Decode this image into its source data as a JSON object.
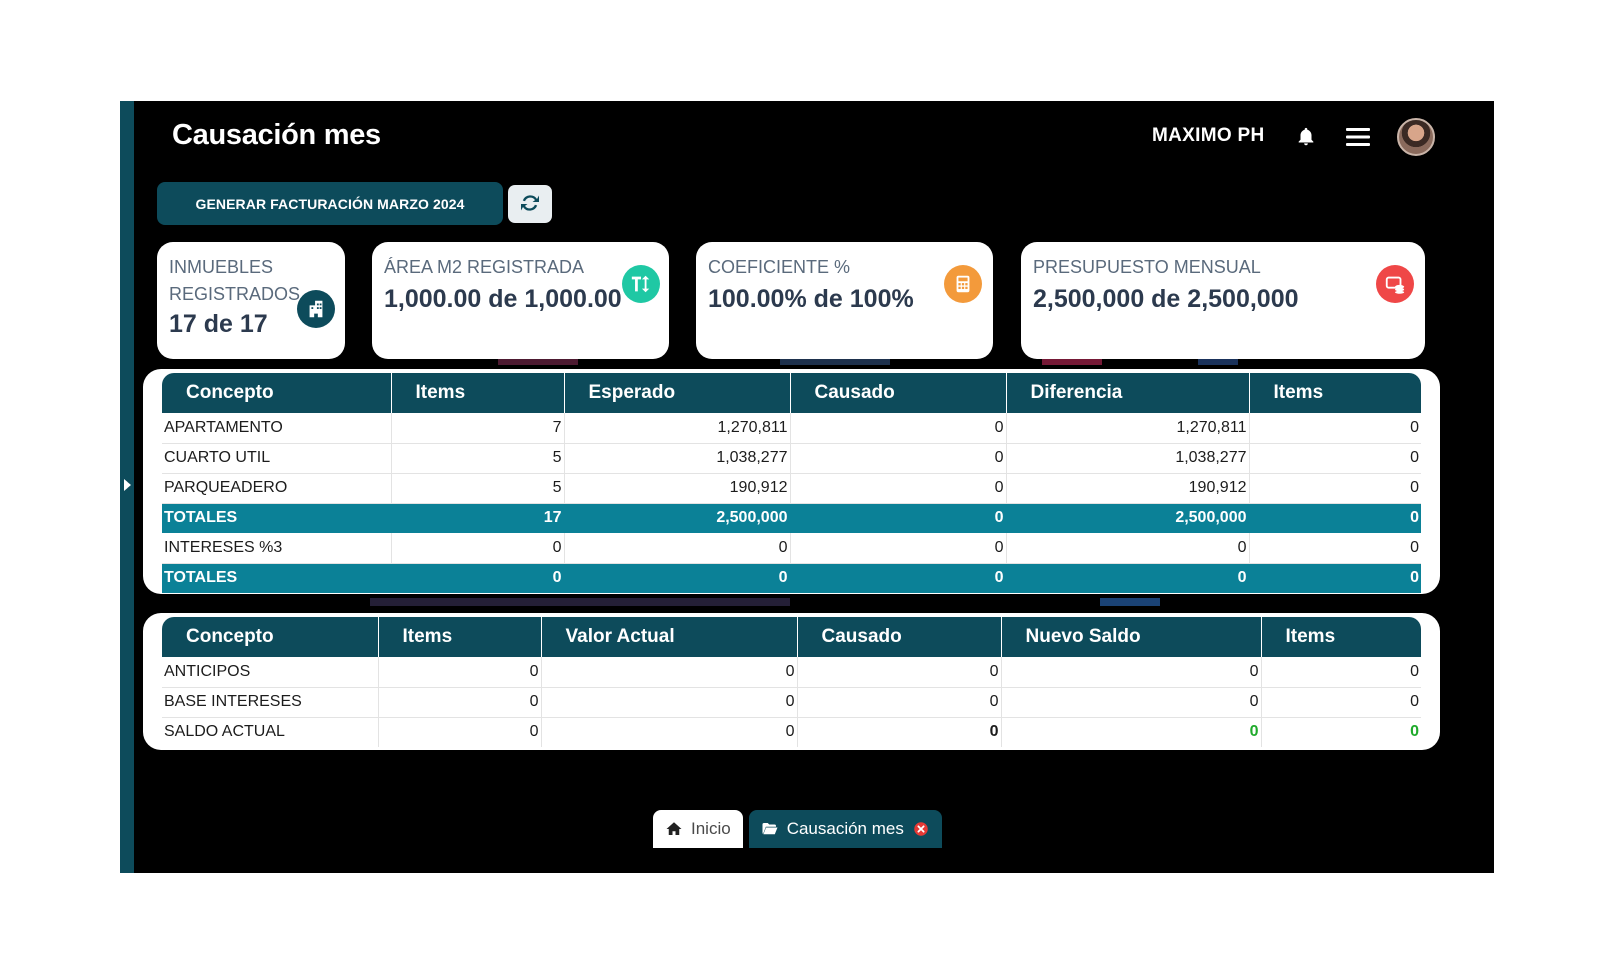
{
  "header": {
    "title": "Causación mes",
    "user": "MAXIMO PH"
  },
  "toolbar": {
    "generate_label": "GENERAR FACTURACIÓN MARZO 2024"
  },
  "stats": [
    {
      "label": "INMUEBLES REGISTRADOS",
      "value": "17 de 17",
      "icon": "building-icon",
      "color": "#0d4b5b"
    },
    {
      "label": "ÁREA M2 REGISTRADA",
      "value": "1,000.00 de 1,000.00",
      "icon": "text-height-icon",
      "color": "#1fc8a4"
    },
    {
      "label": "COEFICIENTE %",
      "value": "100.00% de 100%",
      "icon": "calculator-icon",
      "color": "#f39a3b"
    },
    {
      "label": "PRESUPUESTO MENSUAL",
      "value": "2,500,000 de 2,500,000",
      "icon": "coins-icon",
      "color": "#ef4747"
    }
  ],
  "table1": {
    "headers": [
      "Concepto",
      "Items",
      "Esperado",
      "Causado",
      "Diferencia",
      "Items"
    ],
    "rows": [
      [
        "APARTAMENTO",
        "7",
        "1,270,811",
        "0",
        "1,270,811",
        "0"
      ],
      [
        "CUARTO UTIL",
        "5",
        "1,038,277",
        "0",
        "1,038,277",
        "0"
      ],
      [
        "PARQUEADERO",
        "5",
        "190,912",
        "0",
        "190,912",
        "0"
      ],
      [
        "TOTALES",
        "17",
        "2,500,000",
        "0",
        "2,500,000",
        "0"
      ],
      [
        "INTERESES %3",
        "0",
        "0",
        "0",
        "0",
        "0"
      ],
      [
        "TOTALES",
        "0",
        "0",
        "0",
        "0",
        "0"
      ]
    ]
  },
  "table2": {
    "headers": [
      "Concepto",
      "Items",
      "Valor Actual",
      "Causado",
      "Nuevo Saldo",
      "Items"
    ],
    "rows": [
      [
        "ANTICIPOS",
        "0",
        "0",
        "0",
        "0",
        "0"
      ],
      [
        "BASE INTERESES",
        "0",
        "0",
        "0",
        "0",
        "0"
      ],
      [
        "SALDO ACTUAL",
        "0",
        "0",
        "0",
        "0",
        "0"
      ]
    ]
  },
  "tabs": [
    {
      "label": "Inicio"
    },
    {
      "label": "Causación mes"
    }
  ],
  "colors": {
    "primary": "#0d4b5b",
    "total_row": "#0b8197",
    "positive": "#1faa2b",
    "close": "#e53935"
  }
}
